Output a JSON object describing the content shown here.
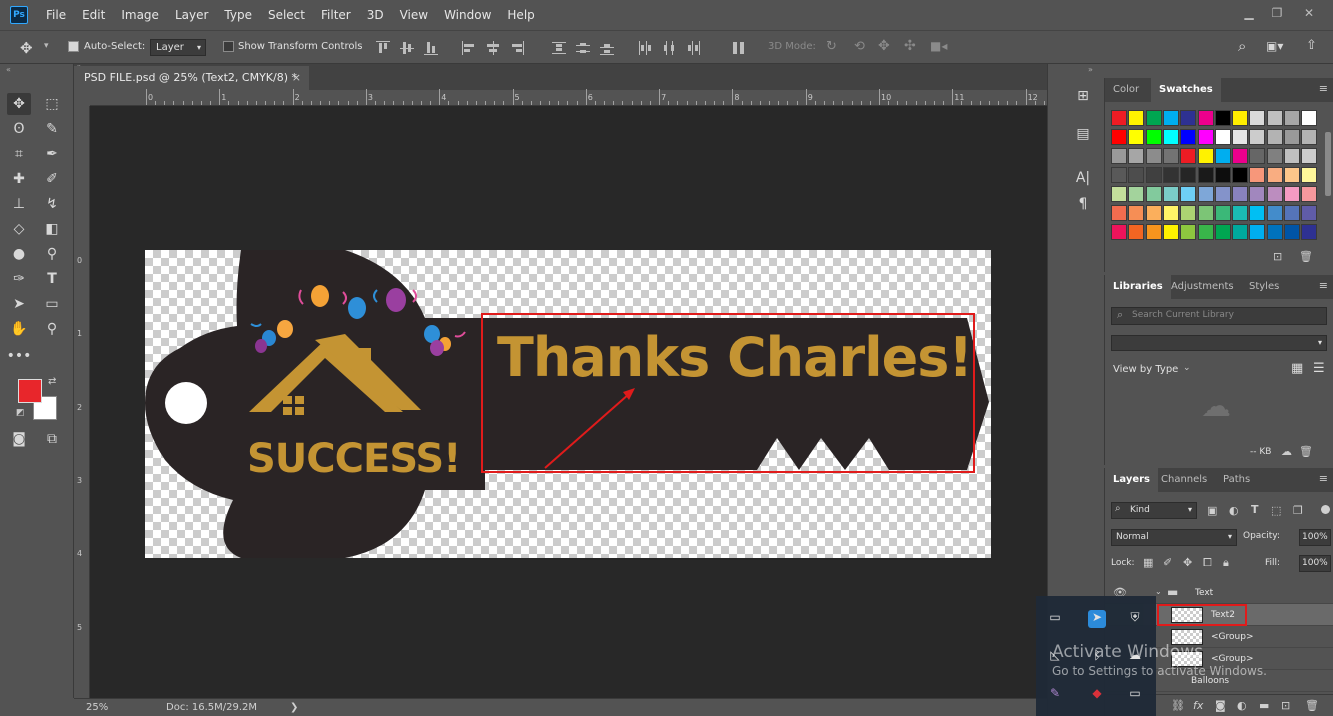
{
  "app": {
    "logo": "Ps"
  },
  "menu": [
    "File",
    "Edit",
    "Image",
    "Layer",
    "Type",
    "Select",
    "Filter",
    "3D",
    "View",
    "Window",
    "Help"
  ],
  "options_bar": {
    "auto_select_label": "Auto-Select:",
    "auto_select_value": "Layer",
    "show_transform_label": "Show Transform Controls",
    "mode_3d_label": "3D Mode:"
  },
  "document_tab": {
    "title": "PSD FILE.psd @ 25% (Text2, CMYK/8) *",
    "close": "×"
  },
  "ruler": {
    "top": [
      "0",
      "1",
      "2",
      "3",
      "4",
      "5",
      "6",
      "7",
      "8",
      "9",
      "10",
      "11",
      "12"
    ],
    "left": [
      "0",
      "1",
      "2",
      "3",
      "4",
      "5"
    ]
  },
  "artwork": {
    "headline": "Thanks Charles!",
    "logo_text": "SUCCESS!",
    "gold": "#c49433",
    "dark": "#2a2425",
    "highlight": "#e01b1b"
  },
  "statusbar": {
    "zoom": "25%",
    "doc": "Doc: 16.5M/29.2M",
    "arrow": "❯"
  },
  "colors": {
    "foreground": "#e8262b",
    "background": "#ffffff"
  },
  "swatches_panel": {
    "tabs": [
      "Color",
      "Swatches"
    ],
    "rows": [
      [
        "#ed1c24",
        "#fff200",
        "#00a651",
        "#00aeef",
        "#2e3192",
        "#ec008c",
        "#000000",
        "#ffee00",
        "#d9d9d9",
        "#bfbfbf",
        "#a6a6a6",
        "#ffffff"
      ],
      [
        "#ff0000",
        "#ffff00",
        "#00ff00",
        "#00ffff",
        "#0000ff",
        "#ff00ff",
        "#ffffff",
        "#e6e6e6",
        "#cccccc",
        "#b3b3b3",
        "#999999",
        "#b3b3b3"
      ],
      [
        "#999999",
        "#a6a6a6",
        "#8c8c8c",
        "#737373",
        "#ed1c24",
        "#fff200",
        "#00aeef",
        "#ec008c",
        "#666666",
        "#808080",
        "#bfbfbf",
        "#cccccc"
      ],
      [
        "#595959",
        "#4d4d4d",
        "#404040",
        "#333333",
        "#262626",
        "#1a1a1a",
        "#0d0d0d",
        "#000000",
        "#f7977a",
        "#f9ad81",
        "#fdc68a",
        "#fff79a"
      ],
      [
        "#c4df9b",
        "#a3d39c",
        "#82ca9d",
        "#7bcdc8",
        "#6ecff6",
        "#7ea7d8",
        "#8493ca",
        "#8882be",
        "#a187be",
        "#bc8dbf",
        "#f49ac2",
        "#f6989d"
      ],
      [
        "#f26c4f",
        "#f68e55",
        "#fbaf5c",
        "#fff467",
        "#acd372",
        "#7cc576",
        "#3bb878",
        "#1abbb4",
        "#00bff3",
        "#438ccb",
        "#5574b9",
        "#605ca8"
      ],
      [
        "#ed145b",
        "#f26522",
        "#f7941d",
        "#fff200",
        "#8dc63f",
        "#39b54a",
        "#00a651",
        "#00a99d",
        "#00aeef",
        "#0072bc",
        "#0054a6",
        "#2e3192"
      ]
    ]
  },
  "libraries_panel": {
    "tabs": [
      "Libraries",
      "Adjustments",
      "Styles"
    ],
    "search_placeholder": "Search Current Library",
    "view_by": "View by Type",
    "size": "-- KB"
  },
  "layers_panel": {
    "tabs": [
      "Layers",
      "Channels",
      "Paths"
    ],
    "kind": "Kind",
    "blend_mode": "Normal",
    "opacity_label": "Opacity:",
    "opacity_value": "100%",
    "lock_label": "Lock:",
    "fill_label": "Fill:",
    "fill_value": "100%",
    "layers": [
      {
        "name": "Text",
        "type": "group"
      },
      {
        "name": "Text2",
        "type": "layer",
        "selected": true
      },
      {
        "name": "<Group>",
        "type": "layer"
      },
      {
        "name": "<Group>",
        "type": "layer"
      },
      {
        "name": "Balloons",
        "type": "group"
      }
    ]
  },
  "overlay": {
    "title": "Activate Windows",
    "subtitle": "Go to Settings to activate Windows."
  }
}
